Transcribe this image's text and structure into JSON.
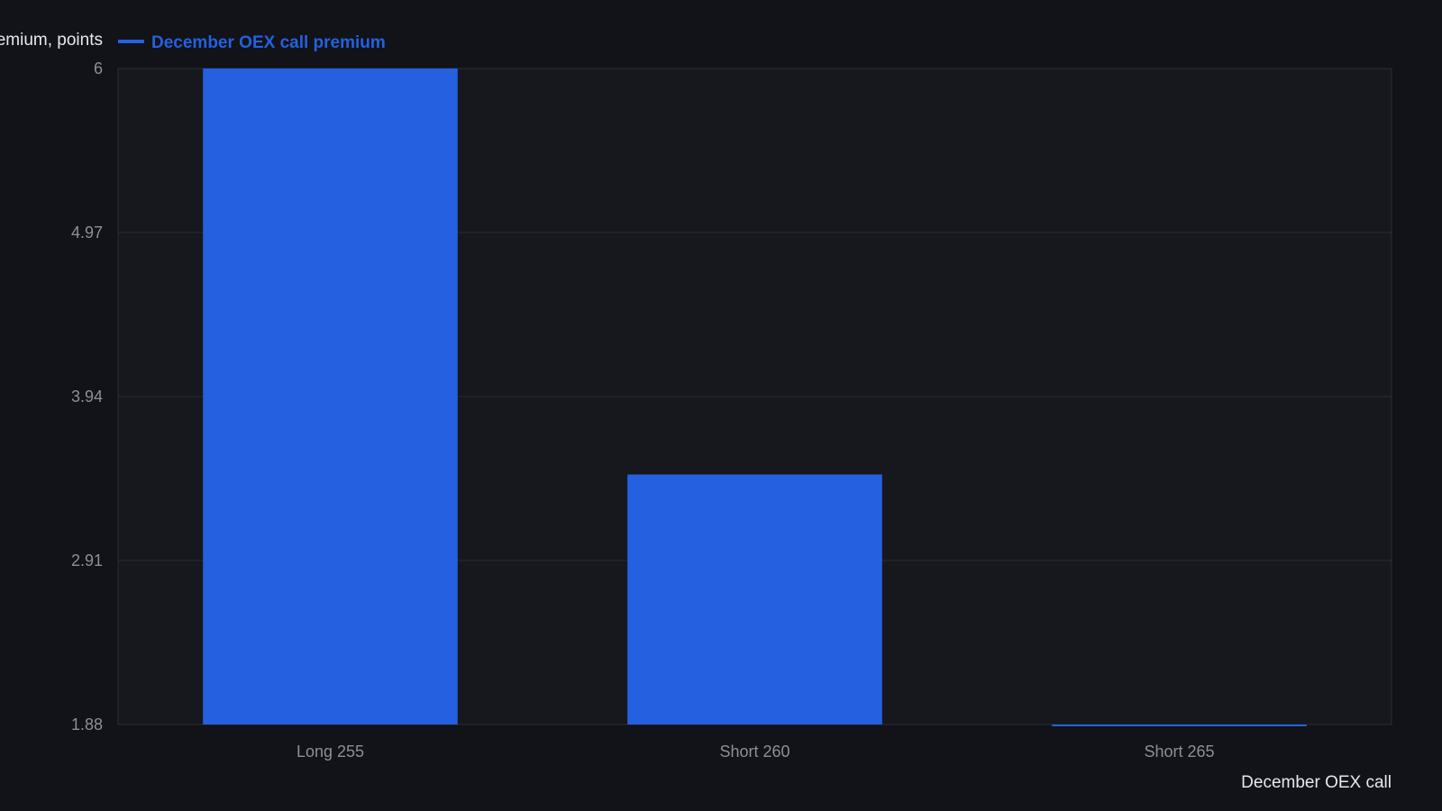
{
  "chart_data": {
    "type": "bar",
    "categories": [
      "Long 255",
      "Short 260",
      "Short 265"
    ],
    "series": [
      {
        "name": "December OEX call premium",
        "values": [
          6.0,
          3.45,
          1.87
        ],
        "color": "#2560e0"
      }
    ],
    "ylim": [
      1.88,
      6
    ],
    "yticks": [
      "1.88",
      "2.91",
      "3.94",
      "4.97",
      "6"
    ],
    "ylabel": "emium, points",
    "xlabel": "December OEX call",
    "legend_position": "top-left",
    "grid": true,
    "colors": {
      "background": "#111318",
      "plot_background": "#16181d",
      "grid": "#2a2d33",
      "bar": "#2560e0"
    }
  }
}
